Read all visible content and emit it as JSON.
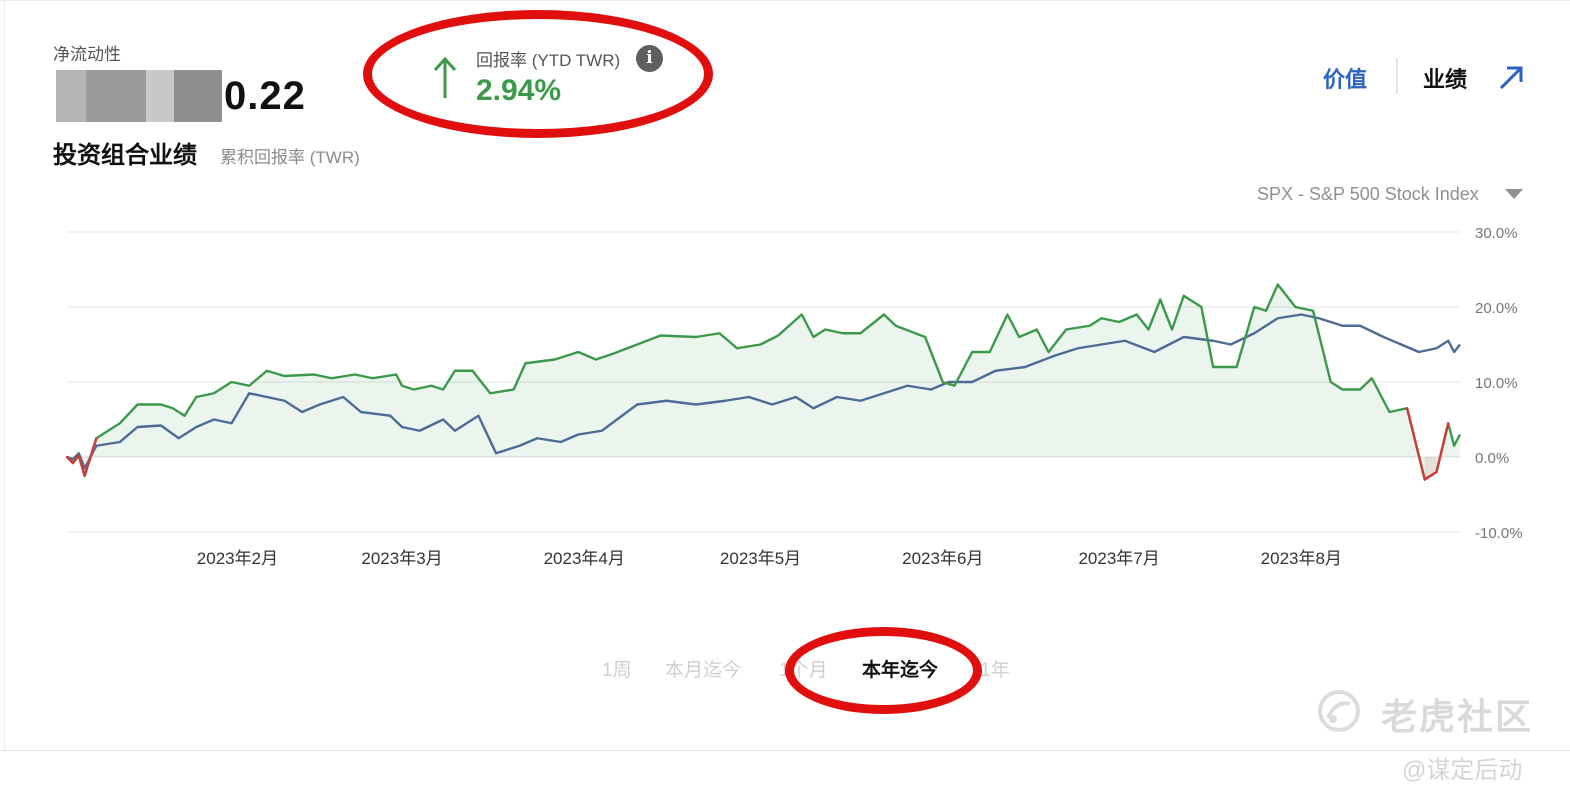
{
  "header": {
    "net_liquidity_label": "净流动性",
    "net_liquidity_value_visible": "0.22",
    "return_label": "回报率 (YTD TWR)",
    "return_value": "2.94%",
    "info_icon": "info-icon",
    "arrow_icon": "arrow-up-icon"
  },
  "title": {
    "main": "投资组合业绩",
    "sub": "累积回报率 (TWR)"
  },
  "tabs": {
    "value": "价值",
    "performance": "业绩",
    "expand_icon": "expand-arrow-icon"
  },
  "benchmark": {
    "selected": "SPX - S&P 500 Stock Index"
  },
  "periods": [
    {
      "label": "1周",
      "active": false
    },
    {
      "label": "本月迄今",
      "active": false
    },
    {
      "label": "1个月",
      "active": false
    },
    {
      "label": "本年迄今",
      "active": true
    },
    {
      "label": "1年",
      "active": false
    }
  ],
  "watermark": {
    "text": "老虎社区",
    "sub": "@谋定后动",
    "icon": "tiger-logo-icon"
  },
  "colors": {
    "portfolio": "#3b9a4a",
    "portfolio_negative": "#d03a36",
    "benchmark": "#4f6a97",
    "accent": "#2a63c4",
    "annotation": "#e10e0e"
  },
  "chart_data": {
    "type": "line",
    "x_start": "2023-01-03",
    "x_end": "2023-08-28",
    "ylim": [
      -10,
      30
    ],
    "y_ticks": [
      "30.0%",
      "20.0%",
      "10.0%",
      "0.0%",
      "-10.0%"
    ],
    "y_tick_values": [
      30,
      20,
      10,
      0,
      -10
    ],
    "x_ticks": [
      {
        "label": "2023年2月",
        "date": "2023-02-01"
      },
      {
        "label": "2023年3月",
        "date": "2023-03-01"
      },
      {
        "label": "2023年4月",
        "date": "2023-04-01"
      },
      {
        "label": "2023年5月",
        "date": "2023-05-01"
      },
      {
        "label": "2023年6月",
        "date": "2023-06-01"
      },
      {
        "label": "2023年7月",
        "date": "2023-07-01"
      },
      {
        "label": "2023年8月",
        "date": "2023-08-01"
      }
    ],
    "grid": true,
    "series": [
      {
        "key": "portfolio",
        "fill": true,
        "points": [
          [
            "2023-01-03",
            0.0
          ],
          [
            "2023-01-04",
            -0.8
          ],
          [
            "2023-01-05",
            0.2
          ],
          [
            "2023-01-06",
            -2.5
          ],
          [
            "2023-01-08",
            2.5
          ],
          [
            "2023-01-10",
            3.5
          ],
          [
            "2023-01-12",
            4.5
          ],
          [
            "2023-01-15",
            7.0
          ],
          [
            "2023-01-19",
            7.0
          ],
          [
            "2023-01-21",
            6.5
          ],
          [
            "2023-01-23",
            5.5
          ],
          [
            "2023-01-25",
            8.0
          ],
          [
            "2023-01-28",
            8.5
          ],
          [
            "2023-01-31",
            10.0
          ],
          [
            "2023-02-03",
            9.5
          ],
          [
            "2023-02-06",
            11.5
          ],
          [
            "2023-02-09",
            10.8
          ],
          [
            "2023-02-14",
            11.0
          ],
          [
            "2023-02-17",
            10.5
          ],
          [
            "2023-02-21",
            11.0
          ],
          [
            "2023-02-24",
            10.5
          ],
          [
            "2023-02-28",
            11.0
          ],
          [
            "2023-03-01",
            9.5
          ],
          [
            "2023-03-03",
            9.0
          ],
          [
            "2023-03-06",
            9.5
          ],
          [
            "2023-03-08",
            9.0
          ],
          [
            "2023-03-10",
            11.5
          ],
          [
            "2023-03-13",
            11.5
          ],
          [
            "2023-03-16",
            8.5
          ],
          [
            "2023-03-20",
            9.0
          ],
          [
            "2023-03-22",
            12.5
          ],
          [
            "2023-03-27",
            13.0
          ],
          [
            "2023-03-31",
            14.0
          ],
          [
            "2023-04-03",
            13.0
          ],
          [
            "2023-04-06",
            13.8
          ],
          [
            "2023-04-10",
            15.0
          ],
          [
            "2023-04-14",
            16.2
          ],
          [
            "2023-04-20",
            16.0
          ],
          [
            "2023-04-24",
            16.5
          ],
          [
            "2023-04-27",
            14.5
          ],
          [
            "2023-05-01",
            15.0
          ],
          [
            "2023-05-04",
            16.2
          ],
          [
            "2023-05-08",
            19.0
          ],
          [
            "2023-05-10",
            16.0
          ],
          [
            "2023-05-12",
            17.0
          ],
          [
            "2023-05-15",
            16.5
          ],
          [
            "2023-05-18",
            16.5
          ],
          [
            "2023-05-22",
            19.0
          ],
          [
            "2023-05-24",
            17.5
          ],
          [
            "2023-05-29",
            16.0
          ],
          [
            "2023-06-01",
            10.0
          ],
          [
            "2023-06-03",
            9.5
          ],
          [
            "2023-06-06",
            14.0
          ],
          [
            "2023-06-09",
            14.0
          ],
          [
            "2023-06-12",
            19.0
          ],
          [
            "2023-06-14",
            16.0
          ],
          [
            "2023-06-17",
            17.0
          ],
          [
            "2023-06-19",
            14.0
          ],
          [
            "2023-06-22",
            17.0
          ],
          [
            "2023-06-26",
            17.5
          ],
          [
            "2023-06-28",
            18.5
          ],
          [
            "2023-07-01",
            18.0
          ],
          [
            "2023-07-04",
            19.0
          ],
          [
            "2023-07-06",
            17.0
          ],
          [
            "2023-07-08",
            21.0
          ],
          [
            "2023-07-10",
            17.0
          ],
          [
            "2023-07-12",
            21.5
          ],
          [
            "2023-07-15",
            20.0
          ],
          [
            "2023-07-17",
            12.0
          ],
          [
            "2023-07-21",
            12.0
          ],
          [
            "2023-07-24",
            20.0
          ],
          [
            "2023-07-26",
            19.5
          ],
          [
            "2023-07-28",
            23.0
          ],
          [
            "2023-07-31",
            20.0
          ],
          [
            "2023-08-03",
            19.5
          ],
          [
            "2023-08-06",
            10.0
          ],
          [
            "2023-08-08",
            9.0
          ],
          [
            "2023-08-11",
            9.0
          ],
          [
            "2023-08-13",
            10.5
          ],
          [
            "2023-08-16",
            6.0
          ],
          [
            "2023-08-19",
            6.5
          ],
          [
            "2023-08-22",
            -3.0
          ],
          [
            "2023-08-24",
            -2.0
          ],
          [
            "2023-08-26",
            4.5
          ],
          [
            "2023-08-27",
            1.5
          ],
          [
            "2023-08-28",
            3.0
          ]
        ]
      },
      {
        "key": "benchmark",
        "fill": false,
        "points": [
          [
            "2023-01-03",
            0.0
          ],
          [
            "2023-01-04",
            -0.3
          ],
          [
            "2023-01-05",
            0.5
          ],
          [
            "2023-01-06",
            -1.5
          ],
          [
            "2023-01-08",
            1.5
          ],
          [
            "2023-01-12",
            2.0
          ],
          [
            "2023-01-15",
            4.0
          ],
          [
            "2023-01-19",
            4.2
          ],
          [
            "2023-01-22",
            2.5
          ],
          [
            "2023-01-25",
            4.0
          ],
          [
            "2023-01-28",
            5.0
          ],
          [
            "2023-01-31",
            4.5
          ],
          [
            "2023-02-03",
            8.5
          ],
          [
            "2023-02-06",
            8.0
          ],
          [
            "2023-02-09",
            7.5
          ],
          [
            "2023-02-12",
            6.0
          ],
          [
            "2023-02-15",
            7.0
          ],
          [
            "2023-02-19",
            8.0
          ],
          [
            "2023-02-22",
            6.0
          ],
          [
            "2023-02-27",
            5.5
          ],
          [
            "2023-03-01",
            4.0
          ],
          [
            "2023-03-04",
            3.5
          ],
          [
            "2023-03-08",
            5.0
          ],
          [
            "2023-03-10",
            3.5
          ],
          [
            "2023-03-14",
            5.5
          ],
          [
            "2023-03-17",
            0.5
          ],
          [
            "2023-03-21",
            1.5
          ],
          [
            "2023-03-24",
            2.5
          ],
          [
            "2023-03-28",
            2.0
          ],
          [
            "2023-03-31",
            3.0
          ],
          [
            "2023-04-04",
            3.5
          ],
          [
            "2023-04-10",
            7.0
          ],
          [
            "2023-04-15",
            7.5
          ],
          [
            "2023-04-20",
            7.0
          ],
          [
            "2023-04-25",
            7.5
          ],
          [
            "2023-04-29",
            8.0
          ],
          [
            "2023-05-03",
            7.0
          ],
          [
            "2023-05-07",
            8.0
          ],
          [
            "2023-05-10",
            6.5
          ],
          [
            "2023-05-14",
            8.0
          ],
          [
            "2023-05-18",
            7.5
          ],
          [
            "2023-05-22",
            8.5
          ],
          [
            "2023-05-26",
            9.5
          ],
          [
            "2023-05-30",
            9.0
          ],
          [
            "2023-06-02",
            10.0
          ],
          [
            "2023-06-06",
            10.0
          ],
          [
            "2023-06-10",
            11.5
          ],
          [
            "2023-06-15",
            12.0
          ],
          [
            "2023-06-20",
            13.5
          ],
          [
            "2023-06-24",
            14.5
          ],
          [
            "2023-06-28",
            15.0
          ],
          [
            "2023-07-02",
            15.5
          ],
          [
            "2023-07-07",
            14.0
          ],
          [
            "2023-07-12",
            16.0
          ],
          [
            "2023-07-17",
            15.5
          ],
          [
            "2023-07-20",
            15.0
          ],
          [
            "2023-07-24",
            16.5
          ],
          [
            "2023-07-28",
            18.5
          ],
          [
            "2023-08-01",
            19.0
          ],
          [
            "2023-08-04",
            18.5
          ],
          [
            "2023-08-08",
            17.5
          ],
          [
            "2023-08-11",
            17.5
          ],
          [
            "2023-08-15",
            16.0
          ],
          [
            "2023-08-18",
            15.0
          ],
          [
            "2023-08-21",
            14.0
          ],
          [
            "2023-08-24",
            14.5
          ],
          [
            "2023-08-26",
            15.5
          ],
          [
            "2023-08-27",
            14.0
          ],
          [
            "2023-08-28",
            15.0
          ]
        ]
      }
    ]
  }
}
